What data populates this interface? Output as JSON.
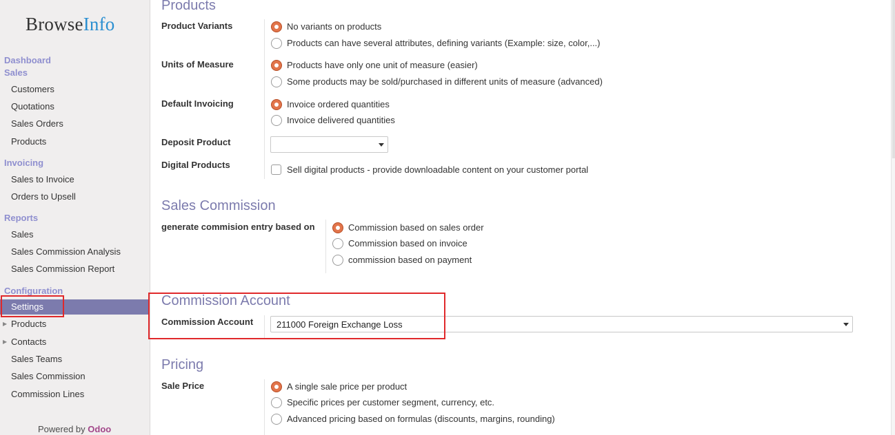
{
  "brand": {
    "part1": "Browse",
    "part2": "Info"
  },
  "sidebar": {
    "dashboard": "Dashboard",
    "sales_head": "Sales",
    "sales_items": [
      "Customers",
      "Quotations",
      "Sales Orders",
      "Products"
    ],
    "invoicing_head": "Invoicing",
    "invoicing_items": [
      "Sales to Invoice",
      "Orders to Upsell"
    ],
    "reports_head": "Reports",
    "reports_items": [
      "Sales",
      "Sales Commission Analysis",
      "Sales Commission Report"
    ],
    "config_head": "Configuration",
    "config_items": [
      "Settings",
      "Products",
      "Contacts",
      "Sales Teams",
      "Sales Commission",
      "Commission Lines"
    ],
    "powered_prefix": "Powered by",
    "powered_brand": "Odoo"
  },
  "products": {
    "title": "Products",
    "variants_label": "Product Variants",
    "variants_opts": [
      "No variants on products",
      "Products can have several attributes, defining variants (Example: size, color,...)"
    ],
    "uom_label": "Units of Measure",
    "uom_opts": [
      "Products have only one unit of measure (easier)",
      "Some products may be sold/purchased in different units of measure (advanced)"
    ],
    "invoicing_label": "Default Invoicing",
    "invoicing_opts": [
      "Invoice ordered quantities",
      "Invoice delivered quantities"
    ],
    "deposit_label": "Deposit Product",
    "deposit_value": "",
    "digital_label": "Digital Products",
    "digital_opt": "Sell digital products - provide downloadable content on your customer portal"
  },
  "commission": {
    "title": "Sales Commission",
    "basis_label": "generate commision entry based on",
    "basis_opts": [
      "Commission based on sales order",
      "Commission based on invoice",
      "commission based on payment"
    ]
  },
  "account": {
    "title": "Commission Account",
    "label": "Commission Account",
    "value": "211000 Foreign Exchange Loss"
  },
  "pricing": {
    "title": "Pricing",
    "label": "Sale Price",
    "opts": [
      "A single sale price per product",
      "Specific prices per customer segment, currency, etc.",
      "Advanced pricing based on formulas (discounts, margins, rounding)"
    ]
  },
  "colors": {
    "accent": "#7c7bad",
    "radio_checked": "#e2754b",
    "highlight": "#e0282a"
  }
}
